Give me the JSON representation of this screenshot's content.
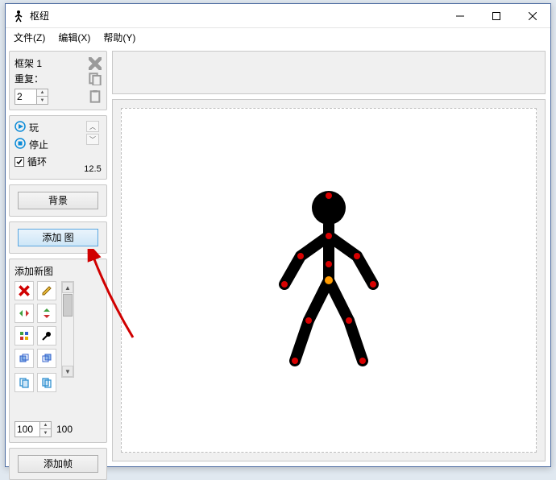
{
  "window": {
    "title": "枢纽"
  },
  "menus": {
    "file": "文件(Z)",
    "edit": "编辑(X)",
    "help": "帮助(Y)"
  },
  "frame_panel": {
    "title": "框架 1",
    "repeat_label": "重复：",
    "repeat_value": "2"
  },
  "playback": {
    "play": "玩",
    "stop": "停止",
    "loop": "循环",
    "fps": "12.5"
  },
  "buttons": {
    "background": "背景",
    "add_figure": "添加 图",
    "add_frame": "添加帧"
  },
  "figure": {
    "section_label": "添加新图",
    "scale_value": "100",
    "scale_readout": "100"
  },
  "tools": {
    "delete": "delete-tool",
    "edit": "edit-tool",
    "flip_h": "flip-horizontal-tool",
    "flip_v": "flip-vertical-tool",
    "center": "center-tool",
    "color": "color-tool",
    "duplicate": "duplicate-tool",
    "join": "join-tool"
  },
  "icons": {
    "app": "stick-figure-app-icon",
    "close_small": "close-frame-icon",
    "copy": "copy-icon",
    "paste": "paste-icon",
    "play": "play-icon",
    "stop": "stop-icon"
  }
}
